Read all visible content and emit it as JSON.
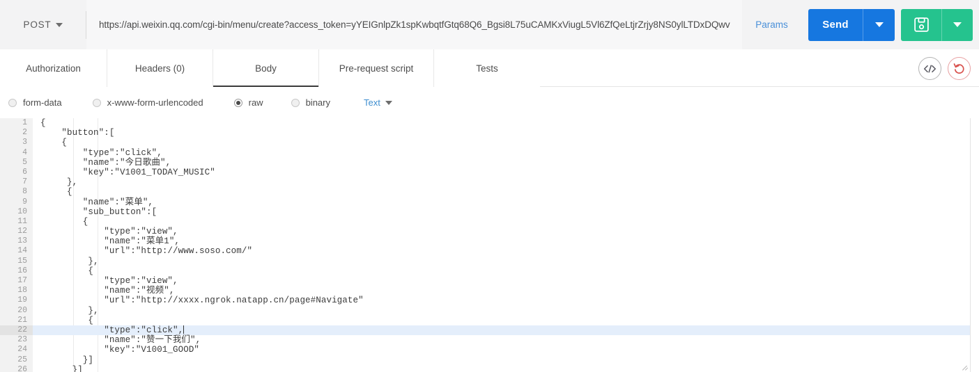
{
  "request": {
    "method": "POST",
    "url": "https://api.weixin.qq.com/cgi-bin/menu/create?access_token=yYEIGnlpZk1spKwbqtfGtq68Q6_Bgsi8L75uCAMKxViugL5Vl6ZfQeLtjrZrjy8NS0ylLTDxDQwv",
    "params_label": "Params",
    "send_label": "Send"
  },
  "tabs": [
    {
      "label": "Authorization",
      "active": false
    },
    {
      "label": "Headers (0)",
      "active": false
    },
    {
      "label": "Body",
      "active": true
    },
    {
      "label": "Pre-request script",
      "active": false
    },
    {
      "label": "Tests",
      "active": false
    }
  ],
  "tabbar_icons": [
    {
      "name": "code-icon",
      "glyph": "</>"
    },
    {
      "name": "reset-icon",
      "glyph": "undo"
    }
  ],
  "body_types": [
    {
      "label": "form-data",
      "checked": false
    },
    {
      "label": "x-www-form-urlencoded",
      "checked": false
    },
    {
      "label": "raw",
      "checked": true
    },
    {
      "label": "binary",
      "checked": false
    }
  ],
  "content_type": {
    "label": "Text"
  },
  "editor": {
    "highlighted_line": 22,
    "cursor_line": 22,
    "lines": [
      {
        "n": 1,
        "text": "{"
      },
      {
        "n": 2,
        "text": "    \"button\":["
      },
      {
        "n": 3,
        "text": "    {"
      },
      {
        "n": 4,
        "text": "        \"type\":\"click\","
      },
      {
        "n": 5,
        "text": "        \"name\":\"今日歌曲\","
      },
      {
        "n": 6,
        "text": "        \"key\":\"V1001_TODAY_MUSIC\""
      },
      {
        "n": 7,
        "text": "     },"
      },
      {
        "n": 8,
        "text": "     {"
      },
      {
        "n": 9,
        "text": "        \"name\":\"菜单\","
      },
      {
        "n": 10,
        "text": "        \"sub_button\":["
      },
      {
        "n": 11,
        "text": "        {"
      },
      {
        "n": 12,
        "text": "            \"type\":\"view\","
      },
      {
        "n": 13,
        "text": "            \"name\":\"菜单1\","
      },
      {
        "n": 14,
        "text": "            \"url\":\"http://www.soso.com/\""
      },
      {
        "n": 15,
        "text": "         },"
      },
      {
        "n": 16,
        "text": "         {"
      },
      {
        "n": 17,
        "text": "            \"type\":\"view\","
      },
      {
        "n": 18,
        "text": "            \"name\":\"视频\","
      },
      {
        "n": 19,
        "text": "            \"url\":\"http://xxxx.ngrok.natapp.cn/page#Navigate\""
      },
      {
        "n": 20,
        "text": "         },"
      },
      {
        "n": 21,
        "text": "         {"
      },
      {
        "n": 22,
        "text": "            \"type\":\"click\","
      },
      {
        "n": 23,
        "text": "            \"name\":\"赞一下我们\","
      },
      {
        "n": 24,
        "text": "            \"key\":\"V1001_GOOD\""
      },
      {
        "n": 25,
        "text": "        }]"
      },
      {
        "n": 26,
        "text": "      }]"
      }
    ]
  },
  "colors": {
    "send_blue": "#1677e0",
    "save_green": "#25c38e",
    "link_blue": "#4a90d9",
    "tab_active": "#3a3a3a",
    "line_highlight": "#e4eefb",
    "reset_red": "#d9534f",
    "toolbar_bg": "#f3f3f4"
  }
}
